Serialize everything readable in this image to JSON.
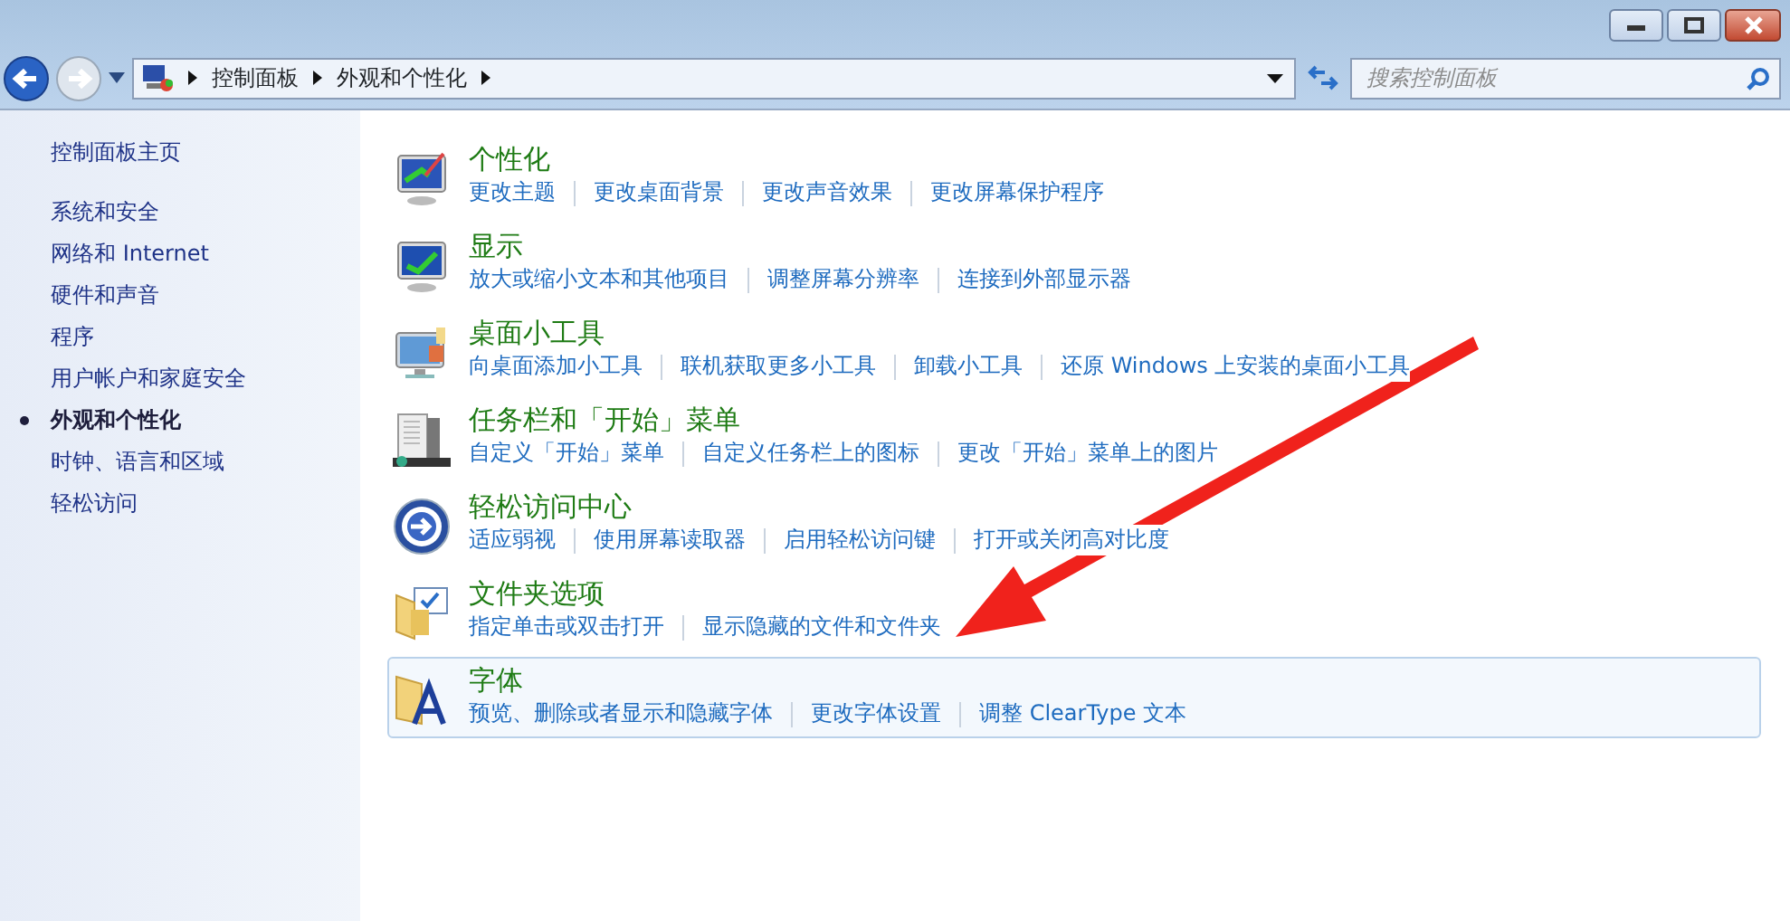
{
  "address_bar": {
    "crumbs": [
      "控制面板",
      "外观和个性化"
    ]
  },
  "search": {
    "placeholder": "搜索控制面板"
  },
  "sidebar": {
    "items": [
      {
        "label": "控制面板主页",
        "selected": false,
        "kind": "home"
      },
      {
        "label": "系统和安全",
        "selected": false,
        "kind": "category"
      },
      {
        "label": "网络和 Internet",
        "selected": false,
        "kind": "category"
      },
      {
        "label": "硬件和声音",
        "selected": false,
        "kind": "category"
      },
      {
        "label": "程序",
        "selected": false,
        "kind": "category"
      },
      {
        "label": "用户帐户和家庭安全",
        "selected": false,
        "kind": "category"
      },
      {
        "label": "外观和个性化",
        "selected": true,
        "kind": "category"
      },
      {
        "label": "时钟、语言和区域",
        "selected": false,
        "kind": "category"
      },
      {
        "label": "轻松访问",
        "selected": false,
        "kind": "category"
      }
    ]
  },
  "sections": [
    {
      "kind": "personalize",
      "title": "个性化",
      "selected": false,
      "links": [
        "更改主题",
        "更改桌面背景",
        "更改声音效果",
        "更改屏幕保护程序"
      ]
    },
    {
      "kind": "display",
      "title": "显示",
      "selected": false,
      "links": [
        "放大或缩小文本和其他项目",
        "调整屏幕分辨率",
        "连接到外部显示器"
      ]
    },
    {
      "kind": "gadgets",
      "title": "桌面小工具",
      "selected": false,
      "links": [
        "向桌面添加小工具",
        "联机获取更多小工具",
        "卸载小工具",
        "还原 Windows 上安装的桌面小工具"
      ]
    },
    {
      "kind": "taskbar",
      "title": "任务栏和「开始」菜单",
      "selected": false,
      "links": [
        "自定义「开始」菜单",
        "自定义任务栏上的图标",
        "更改「开始」菜单上的图片"
      ]
    },
    {
      "kind": "ease",
      "title": "轻松访问中心",
      "selected": false,
      "links": [
        "适应弱视",
        "使用屏幕读取器",
        "启用轻松访问键",
        "打开或关闭高对比度"
      ]
    },
    {
      "kind": "folder",
      "title": "文件夹选项",
      "selected": false,
      "links": [
        "指定单击或双击打开",
        "显示隐藏的文件和文件夹"
      ]
    },
    {
      "kind": "fonts",
      "title": "字体",
      "selected": true,
      "links": [
        "预览、删除或者显示和隐藏字体",
        "更改字体设置",
        "调整 ClearType 文本"
      ]
    }
  ]
}
